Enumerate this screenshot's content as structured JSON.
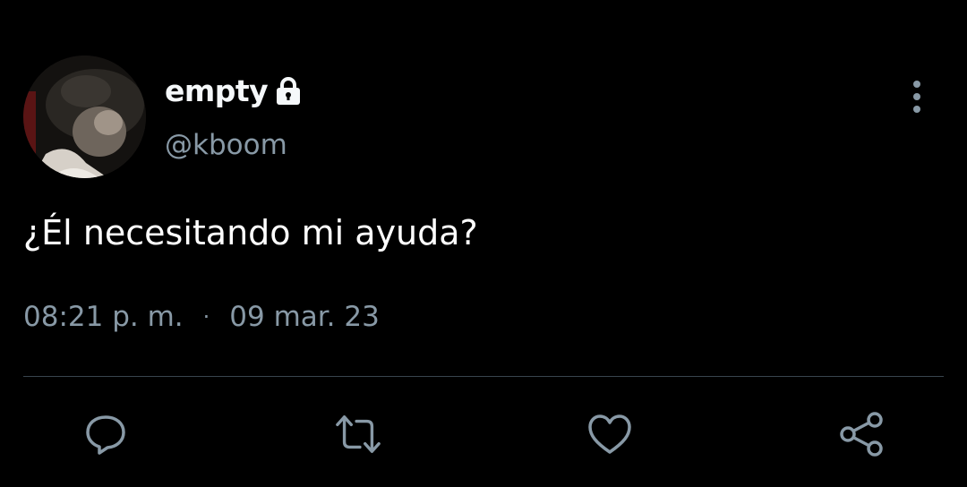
{
  "user": {
    "display_name": "empty",
    "handle": "@kboom",
    "protected_icon": "lock-icon",
    "avatar_icon": "avatar-photo"
  },
  "tweet": {
    "text": "¿Él necesitando mi ayuda?",
    "time": "08:21 p. m.",
    "separator": "·",
    "date": "09 mar. 23"
  },
  "actions": [
    {
      "icon": "reply-icon"
    },
    {
      "icon": "retweet-icon"
    },
    {
      "icon": "like-icon"
    },
    {
      "icon": "share-icon"
    }
  ],
  "menu": {
    "icon": "more-vertical-icon"
  },
  "colors": {
    "background": "#000000",
    "primary_text": "#ffffff",
    "secondary_text": "#8899a6",
    "divider": "#38444d"
  }
}
